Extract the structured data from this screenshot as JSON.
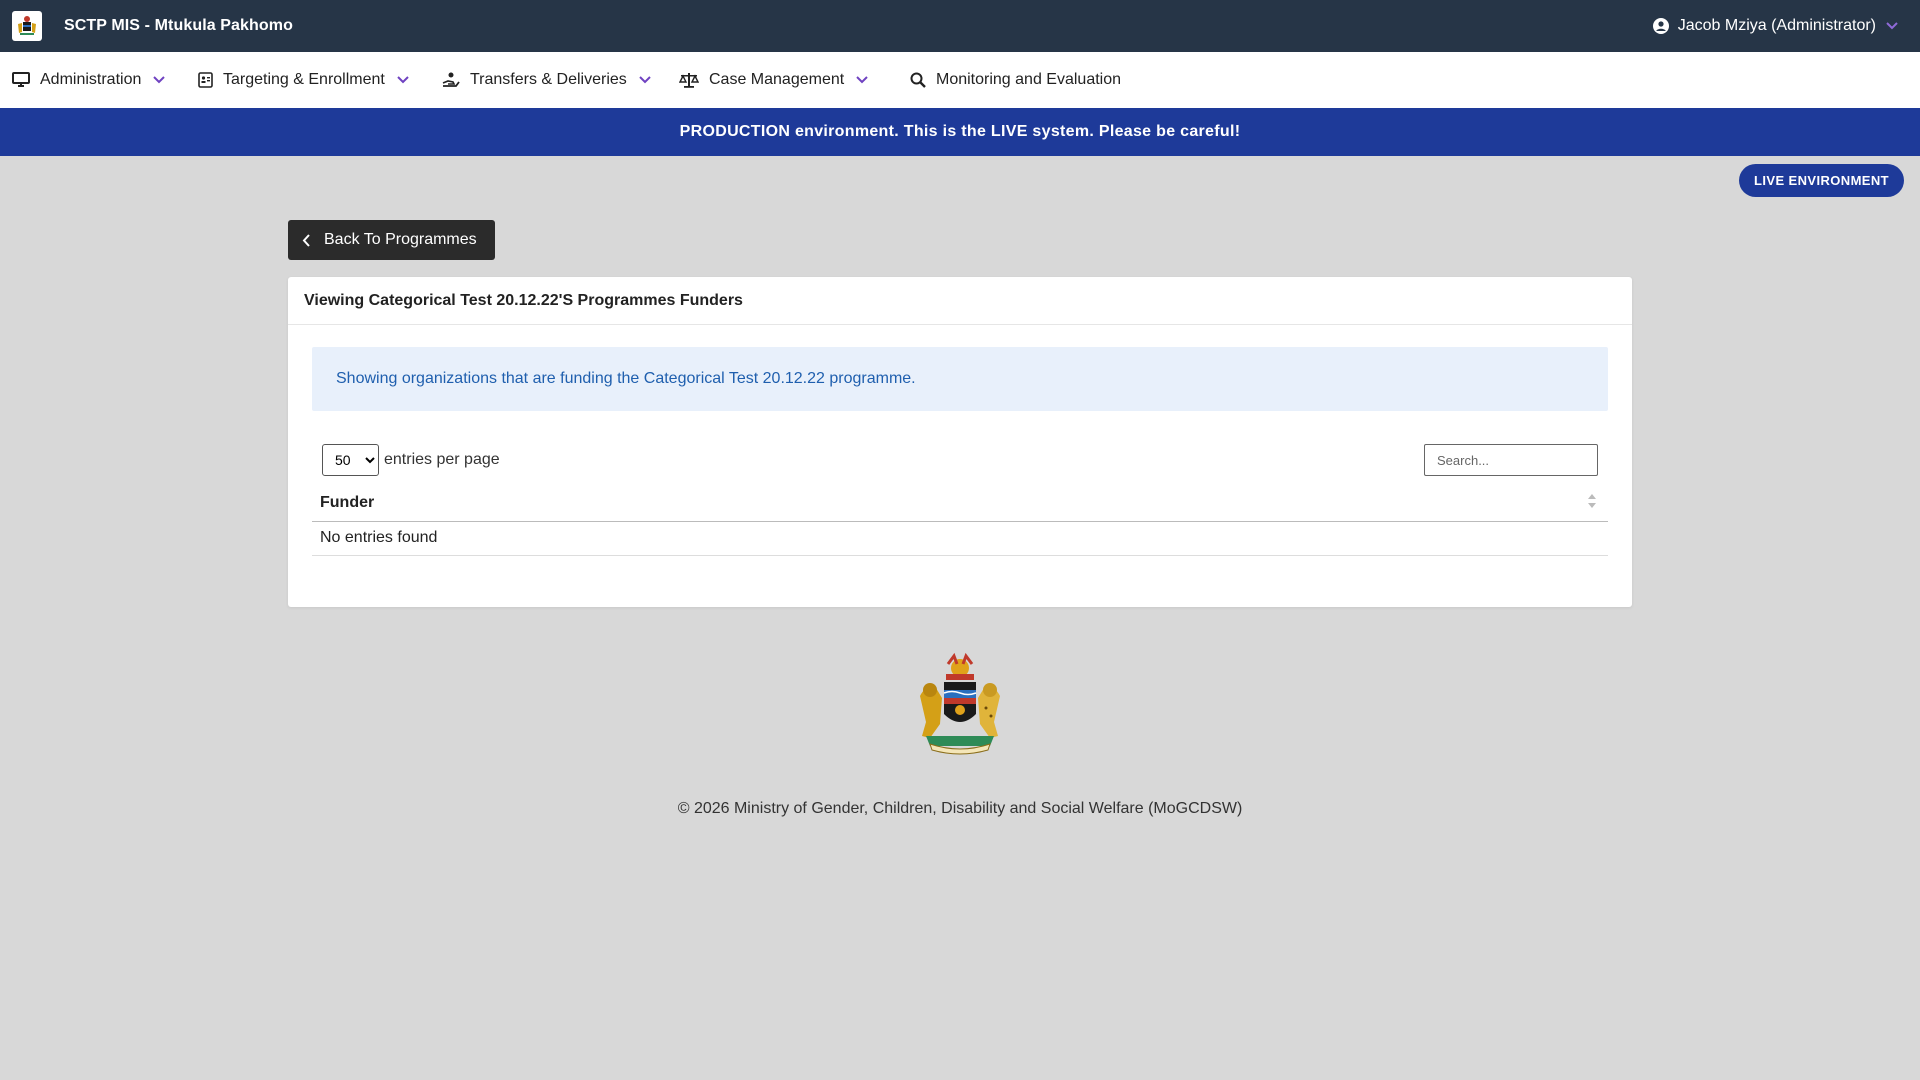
{
  "app": {
    "title": "SCTP MIS - Mtukula Pakhomo",
    "user": "Jacob Mziya (Administrator)"
  },
  "nav": {
    "items": [
      {
        "label": "Administration",
        "icon": "desktop-icon",
        "dropdown": true
      },
      {
        "label": "Targeting & Enrollment",
        "icon": "id-card-icon",
        "dropdown": true
      },
      {
        "label": "Transfers & Deliveries",
        "icon": "hand-coin-icon",
        "dropdown": true
      },
      {
        "label": "Case Management",
        "icon": "scale-icon",
        "dropdown": true
      },
      {
        "label": "Monitoring and Evaluation",
        "icon": "search-icon",
        "dropdown": false
      }
    ]
  },
  "banner": {
    "text": "PRODUCTION environment. This is the LIVE system. Please be careful!",
    "badge": "LIVE ENVIRONMENT"
  },
  "back_button": {
    "label": "Back To Programmes"
  },
  "card": {
    "title": "Viewing Categorical Test 20.12.22'S Programmes Funders",
    "info": "Showing organizations that are funding the Categorical Test 20.12.22 programme.",
    "entries_value": "50",
    "entries_label": "entries per page",
    "search_placeholder": "Search...",
    "table": {
      "columns": [
        "Funder"
      ],
      "empty": "No entries found"
    }
  },
  "footer": {
    "copyright": "© 2026 Ministry of Gender, Children, Disability and Social Welfare (MoGCDSW)"
  },
  "colors": {
    "topbar": "#263547",
    "banner": "#1e3a99",
    "chevron": "#6f42c1",
    "info_text": "#1f5fae"
  }
}
